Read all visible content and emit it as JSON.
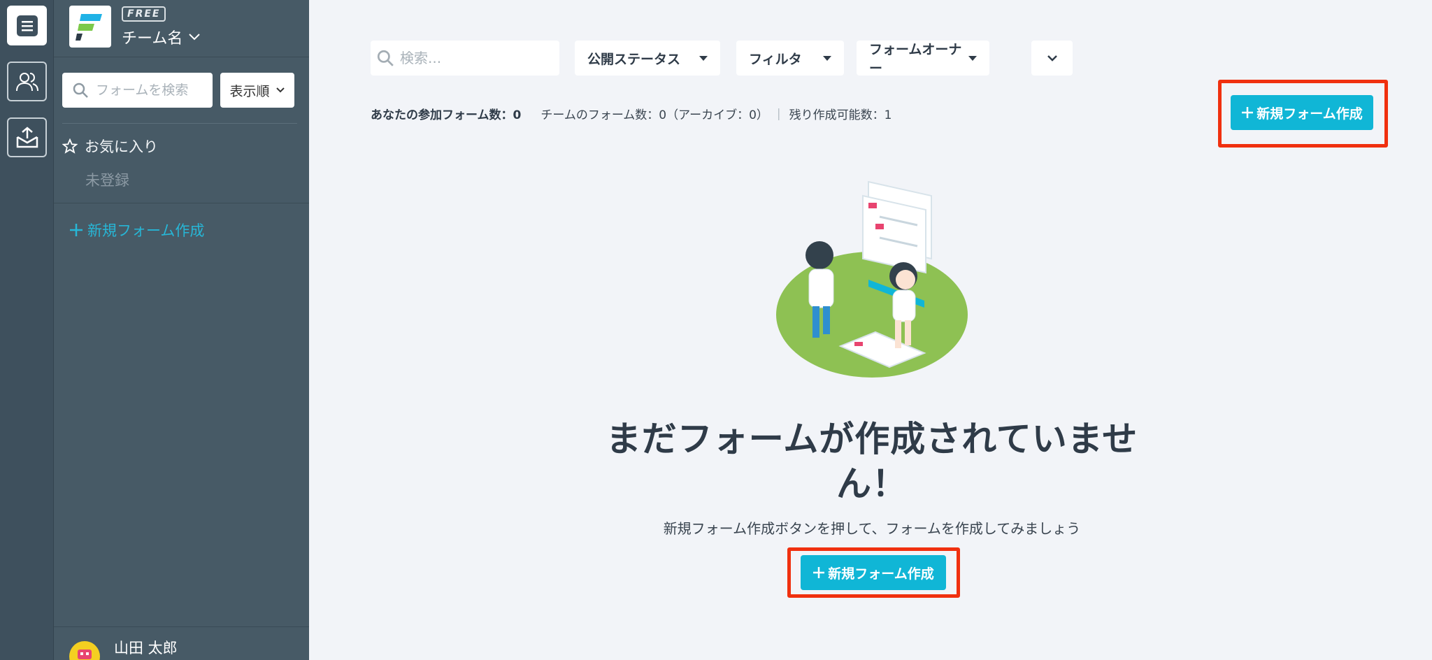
{
  "rail": {
    "items": [
      {
        "icon": "forms-icon"
      },
      {
        "icon": "users-icon"
      },
      {
        "icon": "inbox-upload-icon"
      }
    ]
  },
  "sidebar": {
    "plan_badge": "FREE",
    "team_name": "チーム名",
    "search_placeholder": "フォームを検索",
    "sort_label": "表示順",
    "favorites_label": "お気に入り",
    "favorites_empty": "未登録",
    "new_form_label": "新規フォーム作成",
    "user_name": "山田 太郎"
  },
  "main": {
    "search_placeholder": "検索...",
    "filters": [
      "公開ステータス",
      "フィルタ",
      "フォームオーナー"
    ],
    "stats": {
      "participating": "あなたの参加フォーム数：0",
      "team_forms": "チームのフォーム数：0（アーカイブ：0）",
      "remaining": "残り作成可能数：1"
    },
    "new_form_button": "新規フォーム作成",
    "empty_title": "まだフォームが作成されていません！",
    "empty_subtitle": "新規フォーム作成ボタンを押して、フォームを作成してみましょう",
    "empty_button": "新規フォーム作成"
  },
  "colors": {
    "rail_bg": "#3e505d",
    "sidebar_bg": "#475a66",
    "main_bg": "#f2f4f8",
    "accent": "#10b6d6",
    "highlight": "#f0300f"
  }
}
